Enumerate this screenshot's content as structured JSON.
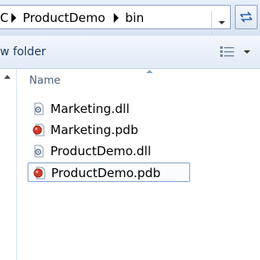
{
  "address": {
    "crumbs": [
      "C",
      "ProductDemo",
      "bin"
    ]
  },
  "toolbar": {
    "new_folder_label": "w folder"
  },
  "file_list": {
    "name_column": "Name",
    "files": [
      {
        "name": "Marketing.dll",
        "icon": "dll-file-icon"
      },
      {
        "name": "Marketing.pdb",
        "icon": "pdb-file-icon"
      },
      {
        "name": "ProductDemo.dll",
        "icon": "dll-file-icon"
      },
      {
        "name": "ProductDemo.pdb",
        "icon": "pdb-file-icon",
        "focused": true
      }
    ]
  },
  "colors": {
    "accent": "#7da2ce",
    "toolbar_text": "#1e395b"
  }
}
